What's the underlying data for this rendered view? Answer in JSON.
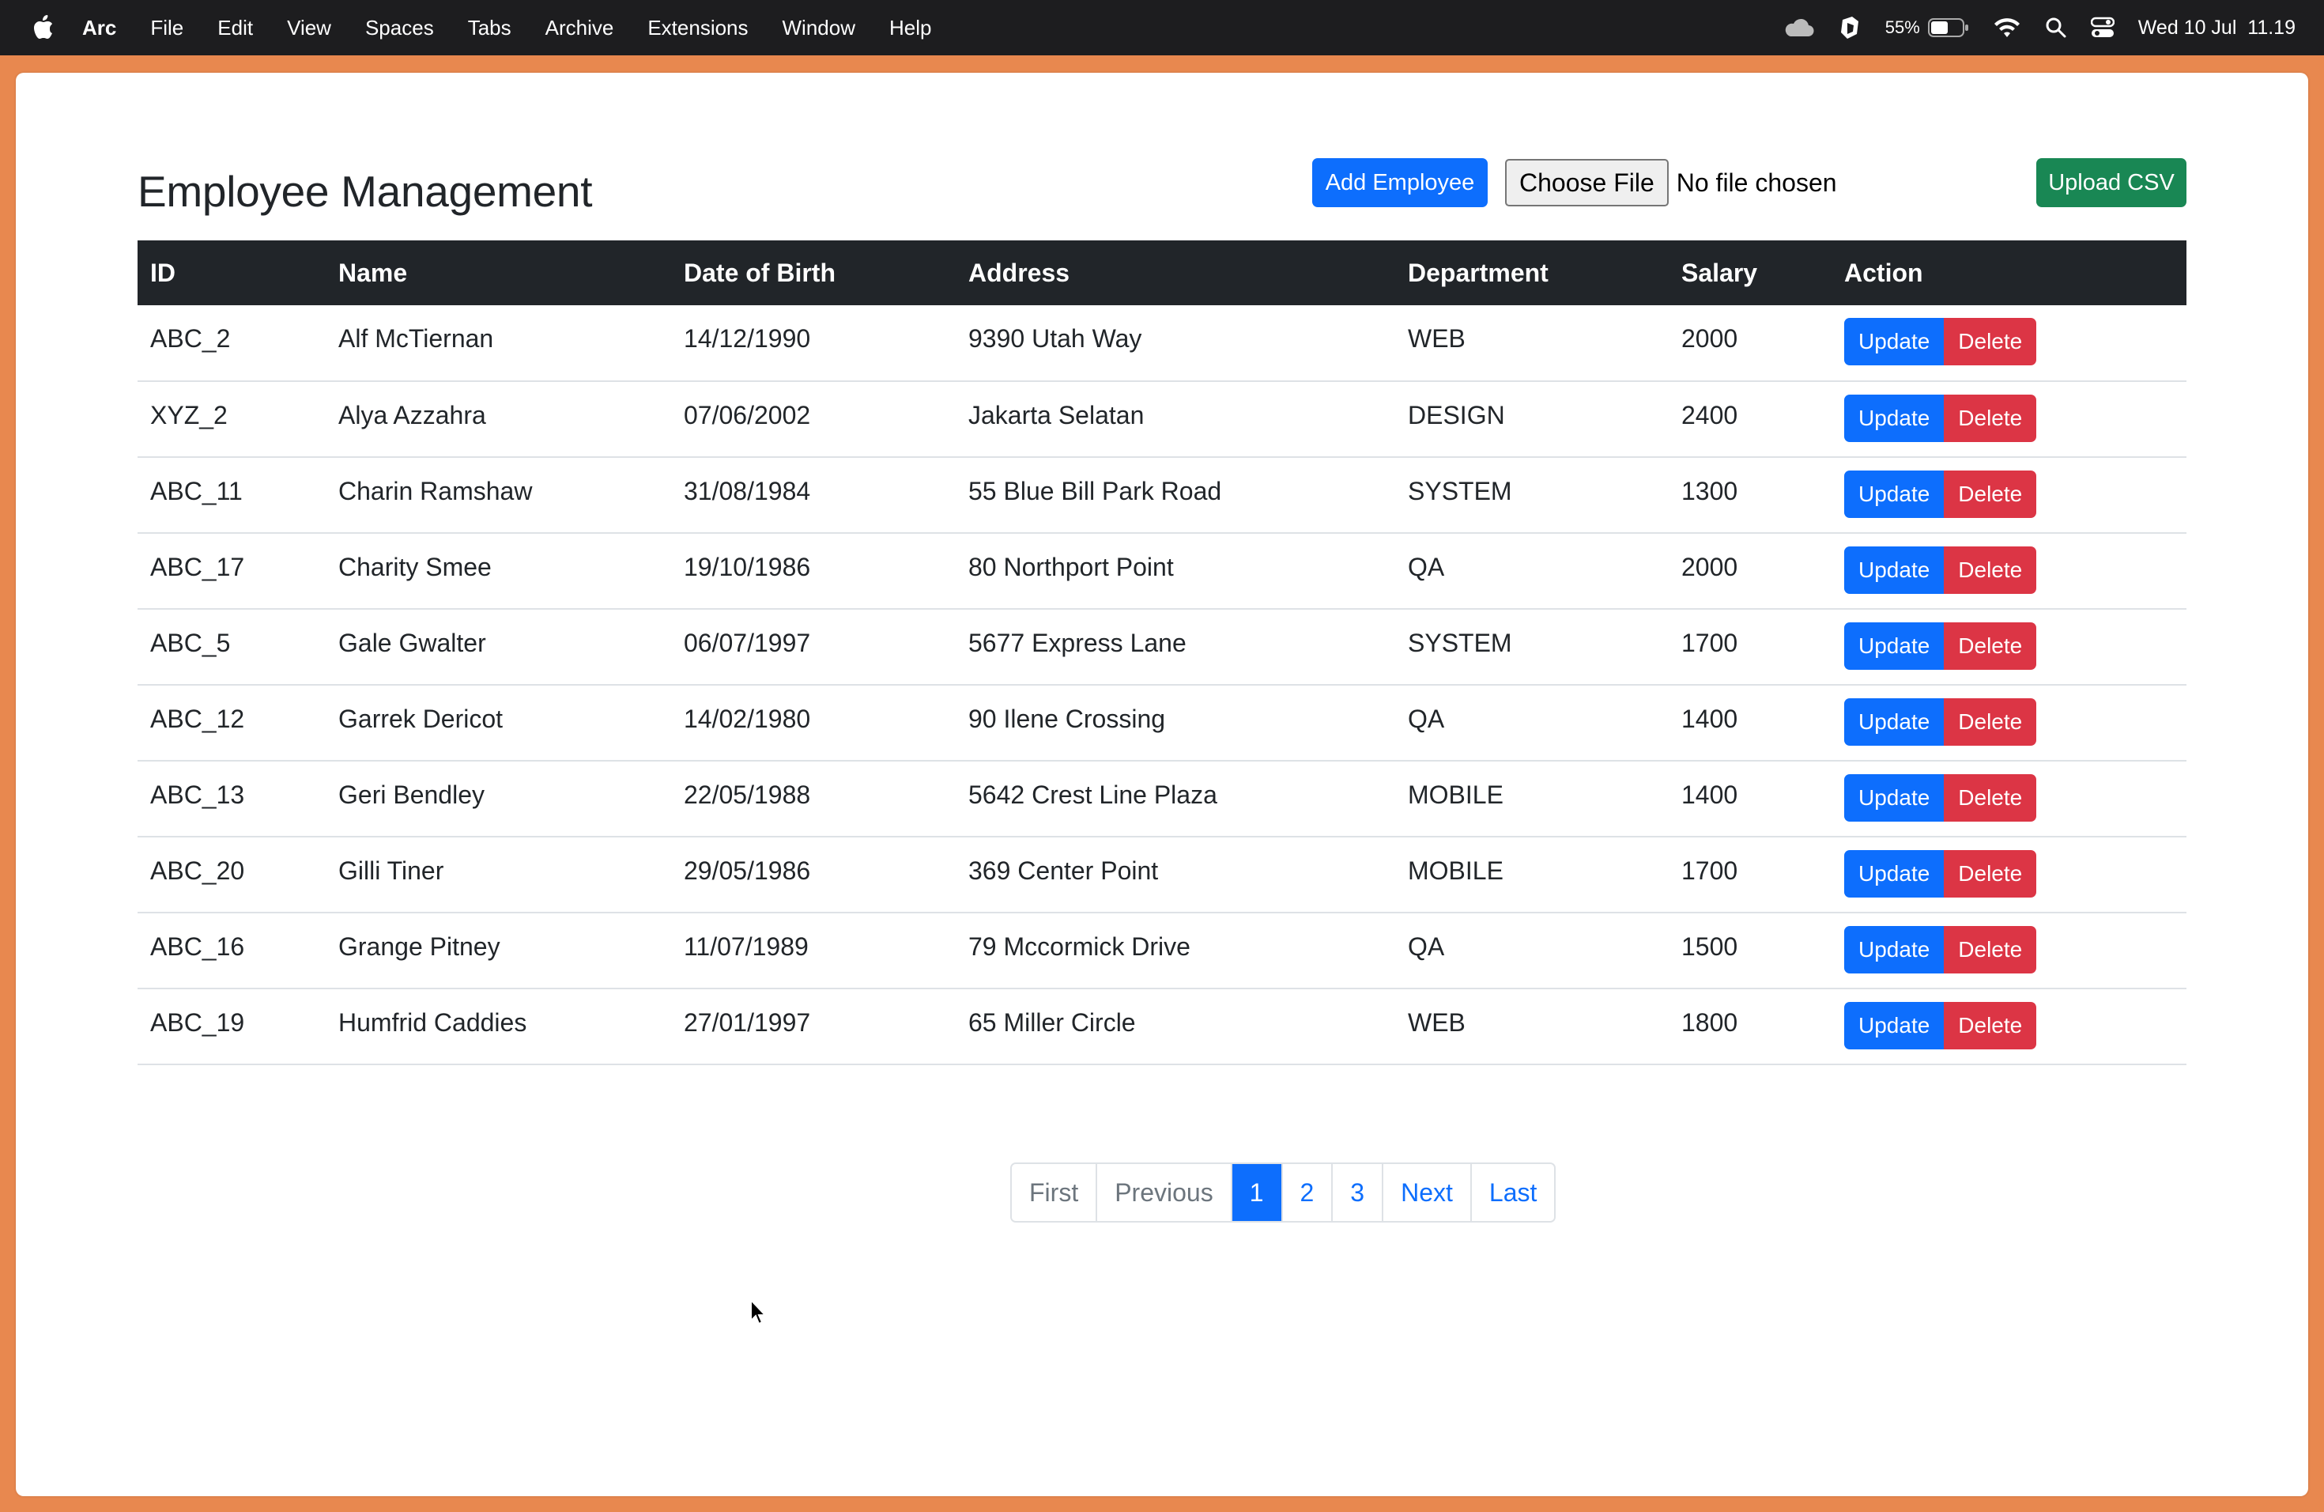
{
  "menubar": {
    "app_name": "Arc",
    "items": [
      "File",
      "Edit",
      "View",
      "Spaces",
      "Tabs",
      "Archive",
      "Extensions",
      "Window",
      "Help"
    ],
    "battery_percent": "55%",
    "battery_level": 0.55,
    "datetime": "Wed 10 Jul  11.19"
  },
  "page": {
    "title": "Employee Management",
    "add_button": "Add Employee",
    "choose_file_button": "Choose File",
    "file_status": "No file chosen",
    "upload_button": "Upload CSV"
  },
  "table": {
    "headers": [
      "ID",
      "Name",
      "Date of Birth",
      "Address",
      "Department",
      "Salary",
      "Action"
    ],
    "update_label": "Update",
    "delete_label": "Delete",
    "rows": [
      {
        "id": "ABC_2",
        "name": "Alf McTiernan",
        "dob": "14/12/1990",
        "address": "9390 Utah Way",
        "department": "WEB",
        "salary": "2000"
      },
      {
        "id": "XYZ_2",
        "name": "Alya Azzahra",
        "dob": "07/06/2002",
        "address": "Jakarta Selatan",
        "department": "DESIGN",
        "salary": "2400"
      },
      {
        "id": "ABC_11",
        "name": "Charin Ramshaw",
        "dob": "31/08/1984",
        "address": "55 Blue Bill Park Road",
        "department": "SYSTEM",
        "salary": "1300"
      },
      {
        "id": "ABC_17",
        "name": "Charity Smee",
        "dob": "19/10/1986",
        "address": "80 Northport Point",
        "department": "QA",
        "salary": "2000"
      },
      {
        "id": "ABC_5",
        "name": "Gale Gwalter",
        "dob": "06/07/1997",
        "address": "5677 Express Lane",
        "department": "SYSTEM",
        "salary": "1700"
      },
      {
        "id": "ABC_12",
        "name": "Garrek Dericot",
        "dob": "14/02/1980",
        "address": "90 Ilene Crossing",
        "department": "QA",
        "salary": "1400"
      },
      {
        "id": "ABC_13",
        "name": "Geri Bendley",
        "dob": "22/05/1988",
        "address": "5642 Crest Line Plaza",
        "department": "MOBILE",
        "salary": "1400"
      },
      {
        "id": "ABC_20",
        "name": "Gilli Tiner",
        "dob": "29/05/1986",
        "address": "369 Center Point",
        "department": "MOBILE",
        "salary": "1700"
      },
      {
        "id": "ABC_16",
        "name": "Grange Pitney",
        "dob": "11/07/1989",
        "address": "79 Mccormick Drive",
        "department": "QA",
        "salary": "1500"
      },
      {
        "id": "ABC_19",
        "name": "Humfrid Caddies",
        "dob": "27/01/1997",
        "address": "65 Miller Circle",
        "department": "WEB",
        "salary": "1800"
      }
    ]
  },
  "pagination": {
    "first": "First",
    "previous": "Previous",
    "pages": [
      "1",
      "2",
      "3"
    ],
    "active_page": "1",
    "next": "Next",
    "last": "Last"
  },
  "colors": {
    "primary": "#0d6efd",
    "danger": "#dc3545",
    "success": "#198754",
    "table_header": "#212529",
    "window_frame": "#e8884f"
  }
}
